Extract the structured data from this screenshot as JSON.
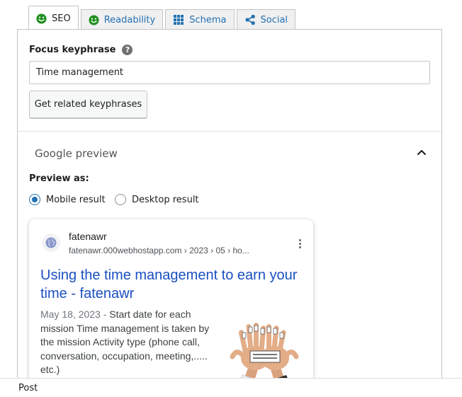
{
  "tabs": [
    {
      "label": "SEO",
      "icon": "smiley-green-icon",
      "active": true
    },
    {
      "label": "Readability",
      "icon": "smiley-green-icon",
      "active": false
    },
    {
      "label": "Schema",
      "icon": "grid-icon",
      "active": false
    },
    {
      "label": "Social",
      "icon": "share-icon",
      "active": false
    }
  ],
  "focus_keyphrase": {
    "label": "Focus keyphrase",
    "help_glyph": "?",
    "value": "Time management"
  },
  "related_button_label": "Get related keyphrases",
  "google_preview": {
    "title": "Google preview",
    "preview_as_label": "Preview as:",
    "options": [
      {
        "label": "Mobile result",
        "checked": true
      },
      {
        "label": "Desktop result",
        "checked": false
      }
    ]
  },
  "result": {
    "site_name": "fatenawr",
    "url": "fatenawr.000webhostapp.com › 2023 › 05 › ho...",
    "title": "Using the time management to earn your time - fatenawr",
    "date": "May 18, 2023",
    "separator": " - ",
    "description": "Start date for each mission Time management is taken by the mission Activity type (phone call, conversation, occupation, meeting,..... etc.)"
  },
  "footer": {
    "label": "Post"
  },
  "colors": {
    "accent": "#2271b1",
    "smiley": "#1e8f1e",
    "link": "#1a4fc2"
  }
}
